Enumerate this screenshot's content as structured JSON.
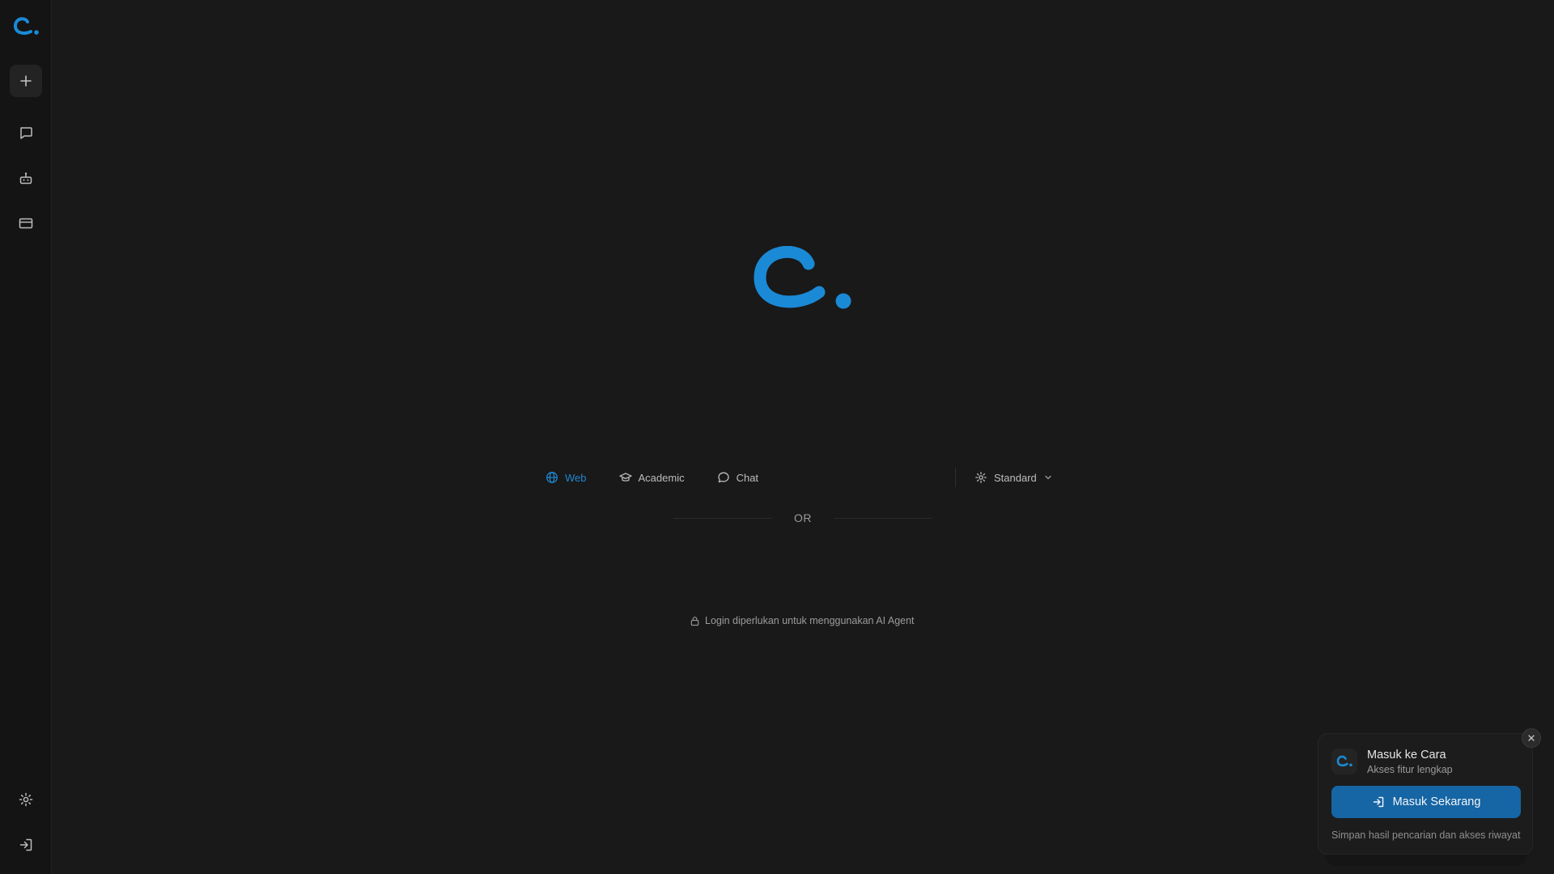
{
  "brand": {
    "accent": "#1a8ad6"
  },
  "sidebar": {
    "items": [
      {
        "name": "new-chat",
        "icon": "plus-icon"
      },
      {
        "name": "chats",
        "icon": "chat-bubble-icon"
      },
      {
        "name": "agents",
        "icon": "robot-icon"
      },
      {
        "name": "billing",
        "icon": "credit-card-icon"
      },
      {
        "name": "settings",
        "icon": "gear-icon"
      },
      {
        "name": "login",
        "icon": "log-in-icon"
      }
    ]
  },
  "modes": {
    "items": [
      {
        "label": "Web",
        "icon": "globe-icon",
        "active": true
      },
      {
        "label": "Academic",
        "icon": "graduation-cap-icon",
        "active": false
      },
      {
        "label": "Chat",
        "icon": "chat-bubble-icon",
        "active": false
      }
    ],
    "standard": {
      "label": "Standard",
      "icon": "gear-icon"
    }
  },
  "divider": {
    "label": "OR"
  },
  "login_note": {
    "text": "Login diperlukan untuk menggunakan AI Agent",
    "icon": "lock-icon"
  },
  "toast": {
    "title": "Masuk ke Cara",
    "subtitle": "Akses fitur lengkap",
    "button_label": "Masuk Sekarang",
    "footer": "Simpan hasil pencarian dan akses riwayat"
  }
}
